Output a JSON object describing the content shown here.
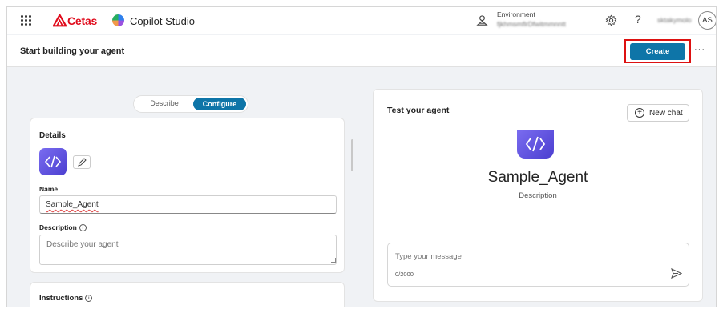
{
  "topbar": {
    "brand": "Cetas",
    "app_name": "Copilot Studio",
    "environment_label": "Environment",
    "environment_value": "fjkhmsmflrDfwitmmnntt",
    "user_name": "sktakymolo",
    "avatar_initials": "AS"
  },
  "header": {
    "title": "Start building your agent",
    "create_label": "Create",
    "more_label": "···"
  },
  "mode_toggle": {
    "options": [
      "Describe",
      "Configure"
    ],
    "selected": "Configure"
  },
  "details": {
    "title": "Details",
    "name_label": "Name",
    "name_value": "Sample_Agent",
    "description_label": "Description",
    "description_placeholder": "Describe your agent"
  },
  "instructions": {
    "title": "Instructions"
  },
  "test_panel": {
    "title": "Test your agent",
    "new_chat_label": "New chat",
    "agent_name": "Sample_Agent",
    "agent_description": "Description",
    "message_placeholder": "Type your message",
    "char_count": "0/2000"
  },
  "colors": {
    "primary": "#0e75a8",
    "highlight_border": "#dd1111",
    "brand_red": "#e00b1c",
    "agent_icon": "#5a4be0"
  }
}
